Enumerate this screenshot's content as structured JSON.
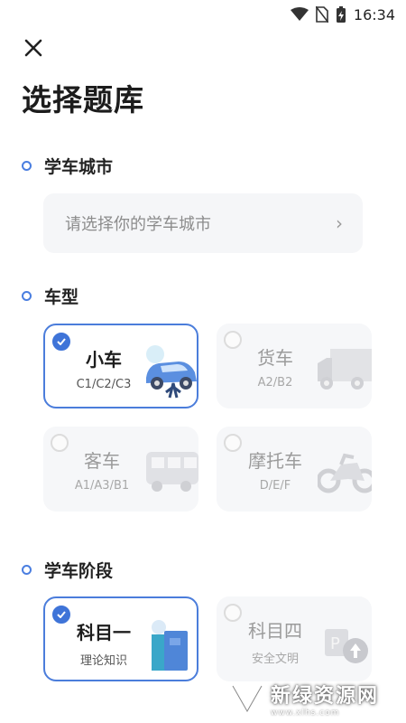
{
  "status_bar": {
    "time": "16:34"
  },
  "header": {
    "title": "选择题库"
  },
  "city": {
    "label": "学车城市",
    "placeholder": "请选择你的学车城市"
  },
  "vehicle": {
    "label": "车型",
    "options": [
      {
        "name": "小车",
        "codes": "C1/C2/C3",
        "selected": true
      },
      {
        "name": "货车",
        "codes": "A2/B2",
        "selected": false
      },
      {
        "name": "客车",
        "codes": "A1/A3/B1",
        "selected": false
      },
      {
        "name": "摩托车",
        "codes": "D/E/F",
        "selected": false
      }
    ]
  },
  "stage": {
    "label": "学车阶段",
    "options": [
      {
        "name": "科目一",
        "desc": "理论知识",
        "selected": true
      },
      {
        "name": "科目四",
        "desc": "安全文明",
        "selected": false
      }
    ]
  },
  "watermark": {
    "text": "新绿资源网",
    "sub": "www.xlhs.com"
  },
  "colors": {
    "accent": "#3f74d8",
    "card_bg": "#f6f7f9",
    "section_dot": "#4a7ee0"
  }
}
